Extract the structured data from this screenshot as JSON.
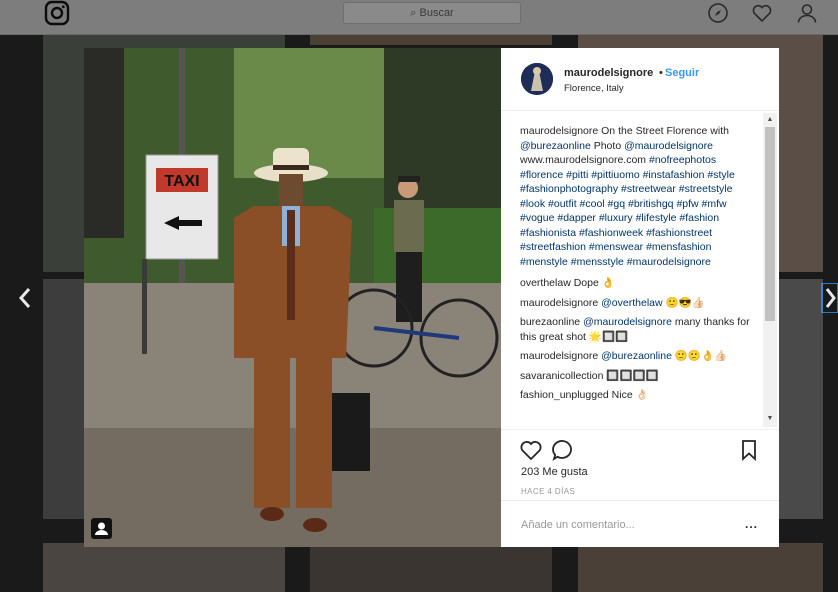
{
  "topbar": {
    "search_placeholder": "Buscar",
    "icons": [
      "instagram-icon",
      "compass-icon",
      "heart-icon",
      "profile-icon"
    ]
  },
  "post": {
    "username": "maurodelsignore",
    "follow_label": "Seguir",
    "separator": "•",
    "location": "Florence, Italy",
    "photo_sign_text": "TAXI",
    "caption": {
      "user": "maurodelsignore",
      "text_a": "On the Street Florence with",
      "mention_a": "@burezaonline",
      "text_b": "Photo",
      "mention_b": "@maurodelsignore",
      "site": "www.maurodelsignore.com",
      "hashtags": "#nofreephotos #florence #pitti #pittiuomo #instafashion #style #fashionphotography #streetwear #streetstyle #look #outfit #cool #gq #britishgq #pfw #mfw #vogue #dapper #luxury #lifestyle #fashion #fashionista #fashionweek #fashionstreet #streetfashion #menswear #mensfashion #menstyle #mensstyle #maurodelsignore"
    },
    "comments": [
      {
        "user": "overthelaw",
        "text": "Dope 👌"
      },
      {
        "user": "maurodelsignore",
        "mention": "@overthelaw",
        "text": "🙂😎👍🏻"
      },
      {
        "user": "burezaonline",
        "mention": "@maurodelsignore",
        "text": "many thanks for this great shot 🌟🔲🔲"
      },
      {
        "user": "maurodelsignore",
        "mention": "@burezaonline",
        "text": "🙂🙂👌👍🏻"
      },
      {
        "user": "savaranicollection",
        "text": "🔲🔲🔲🔲"
      },
      {
        "user": "fashion_unplugged",
        "text": "Nice 👌🏻"
      }
    ],
    "likes": "203 Me gusta",
    "time": "HACE 4 DÍAS",
    "add_comment_placeholder": "Añade un comentario...",
    "more_label": "..."
  }
}
